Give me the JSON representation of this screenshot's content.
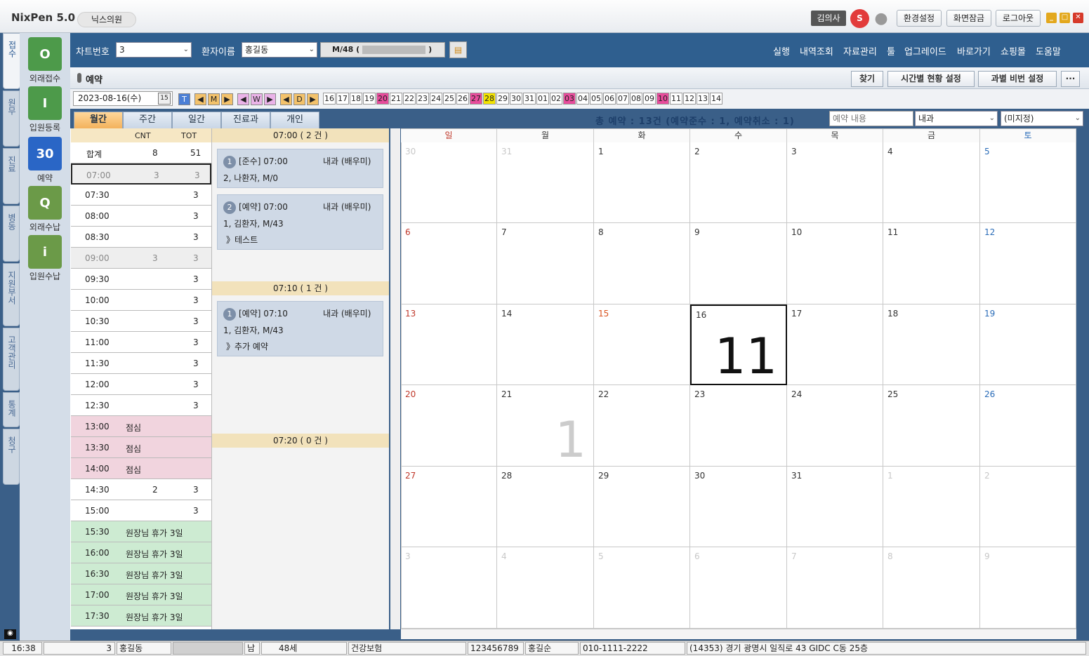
{
  "app": {
    "name": "NixPen 5.0",
    "clinic": "닉스의원",
    "doctor": "김의사",
    "sig": "S",
    "settings": "환경설정",
    "lock": "화면잠금",
    "logout": "로그아웃"
  },
  "left_tabs": [
    "접수",
    "원무",
    "진료",
    "병동",
    "지원부서",
    "고객관리",
    "통계",
    "청구"
  ],
  "side_icons": [
    {
      "label": "외래접수",
      "glyph": "O"
    },
    {
      "label": "입원등록",
      "glyph": "I"
    },
    {
      "label": "예약",
      "glyph": "30"
    },
    {
      "label": "외래수납",
      "glyph": "Q"
    },
    {
      "label": "입원수납",
      "glyph": "i"
    }
  ],
  "toprow": {
    "chart_label": "차트번호",
    "chart_value": "3",
    "patient_label": "환자이름",
    "patient_value": "홍길동",
    "patient_info": "M/48 (",
    "patient_info_end": ")"
  },
  "menu": [
    "실행",
    "내역조회",
    "자료관리",
    "툴",
    "업그레이드",
    "바로가기",
    "쇼핑몰",
    "도움말"
  ],
  "subhead": {
    "title": "예약",
    "find": "찾기",
    "time_setting": "시간별 현황 설정",
    "dept_setting": "과별 비번 설정",
    "more": "···"
  },
  "date": {
    "value": "2023-08-16(수)",
    "cal_btn": "15",
    "t": "T",
    "m": "M",
    "w": "W",
    "d": "D"
  },
  "days": [
    "16",
    "17",
    "18",
    "19",
    "20",
    "21",
    "22",
    "23",
    "24",
    "25",
    "26",
    "27",
    "28",
    "29",
    "30",
    "31",
    "01",
    "02",
    "03",
    "04",
    "05",
    "06",
    "07",
    "08",
    "09",
    "10",
    "11",
    "12",
    "13",
    "14"
  ],
  "tabs": [
    "월간",
    "주간",
    "일간",
    "진료과",
    "개인"
  ],
  "summary": "총 예약 : 13건 (예약준수 : 1, 예약취소 : 1)",
  "filters": {
    "content_placeholder": "예약 내용",
    "dept": "내과",
    "doctor": "(미지정)"
  },
  "timetable": {
    "h_cnt": "CNT",
    "h_tot": "TOT",
    "rows": [
      {
        "t": "합계",
        "c": "8",
        "v": "51"
      },
      {
        "t": "07:00",
        "c": "3",
        "v": "3"
      },
      {
        "t": "07:30",
        "c": "",
        "v": "3"
      },
      {
        "t": "08:00",
        "c": "",
        "v": "3"
      },
      {
        "t": "08:30",
        "c": "",
        "v": "3"
      },
      {
        "t": "09:00",
        "c": "3",
        "v": "3"
      },
      {
        "t": "09:30",
        "c": "",
        "v": "3"
      },
      {
        "t": "10:00",
        "c": "",
        "v": "3"
      },
      {
        "t": "10:30",
        "c": "",
        "v": "3"
      },
      {
        "t": "11:00",
        "c": "",
        "v": "3"
      },
      {
        "t": "11:30",
        "c": "",
        "v": "3"
      },
      {
        "t": "12:00",
        "c": "",
        "v": "3"
      },
      {
        "t": "12:30",
        "c": "",
        "v": "3"
      },
      {
        "t": "13:00",
        "n": "점심"
      },
      {
        "t": "13:30",
        "n": "점심"
      },
      {
        "t": "14:00",
        "n": "점심"
      },
      {
        "t": "14:30",
        "c": "2",
        "v": "3"
      },
      {
        "t": "15:00",
        "c": "",
        "v": "3"
      },
      {
        "t": "15:30",
        "n": "원장님 휴가 3일"
      },
      {
        "t": "16:00",
        "n": "원장님 휴가 3일"
      },
      {
        "t": "16:30",
        "n": "원장님 휴가 3일"
      },
      {
        "t": "17:00",
        "n": "원장님 휴가 3일"
      },
      {
        "t": "17:30",
        "n": "원장님 휴가 3일"
      }
    ]
  },
  "slots": [
    {
      "label": "07:00 ( 2 건 )"
    },
    {
      "label": "07:10 ( 1 건 )"
    },
    {
      "label": "07:20 ( 0 건 )"
    }
  ],
  "cards": [
    {
      "no": "1",
      "status": "[준수] 07:00",
      "dept": "내과 (배우미)",
      "patient": "2, 나환자, M/0",
      "memo": ""
    },
    {
      "no": "2",
      "status": "[예약] 07:00",
      "dept": "내과 (배우미)",
      "patient": "1, 김환자, M/43",
      "memo": "》테스트"
    },
    {
      "no": "1",
      "status": "[예약] 07:10",
      "dept": "내과 (배우미)",
      "patient": "1, 김환자, M/43",
      "memo": "》추가 예약"
    }
  ],
  "calendar": {
    "dow": [
      "일",
      "월",
      "화",
      "수",
      "목",
      "금",
      "토"
    ],
    "weeks": [
      [
        "30",
        "31",
        "1",
        "2",
        "3",
        "4",
        "5"
      ],
      [
        "6",
        "7",
        "8",
        "9",
        "10",
        "11",
        "12"
      ],
      [
        "13",
        "14",
        "15",
        "16",
        "17",
        "18",
        "19"
      ],
      [
        "20",
        "21",
        "22",
        "23",
        "24",
        "25",
        "26"
      ],
      [
        "27",
        "28",
        "29",
        "30",
        "31",
        "1",
        "2"
      ],
      [
        "3",
        "4",
        "5",
        "6",
        "7",
        "8",
        "9"
      ]
    ],
    "counts": {
      "16": "11",
      "21": "1"
    }
  },
  "status": {
    "time": "16:38",
    "chart": "3",
    "name": "홍길동",
    "sex": "남",
    "age": "48세",
    "ins": "건강보험",
    "num": "123456789",
    "guardian": "홍길순",
    "phone": "010-1111-2222",
    "addr": "(14353) 경기 광명시 일직로 43 GIDC C동 25층"
  },
  "colors": {
    "accent": "#2f5f8f",
    "pink": "#e84c9c",
    "yellow": "#f4e400"
  }
}
